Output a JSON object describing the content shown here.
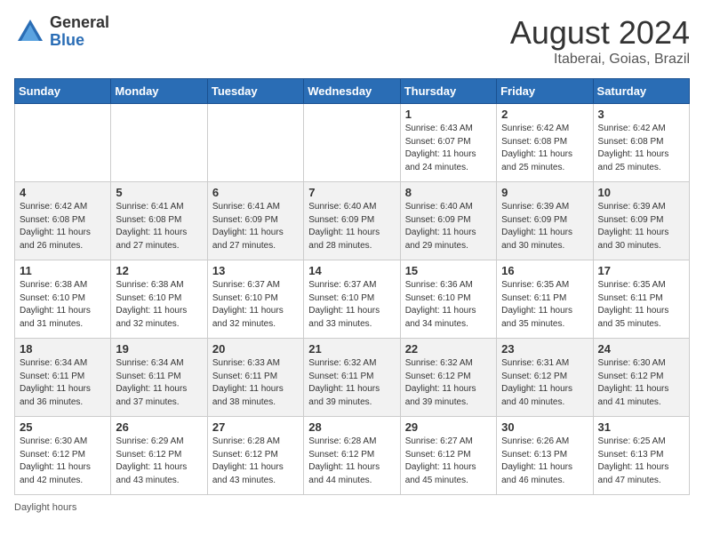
{
  "header": {
    "logo_general": "General",
    "logo_blue": "Blue",
    "month_year": "August 2024",
    "location": "Itaberai, Goias, Brazil"
  },
  "days_of_week": [
    "Sunday",
    "Monday",
    "Tuesday",
    "Wednesday",
    "Thursday",
    "Friday",
    "Saturday"
  ],
  "weeks": [
    [
      {
        "day": "",
        "info": ""
      },
      {
        "day": "",
        "info": ""
      },
      {
        "day": "",
        "info": ""
      },
      {
        "day": "",
        "info": ""
      },
      {
        "day": "1",
        "info": "Sunrise: 6:43 AM\nSunset: 6:07 PM\nDaylight: 11 hours\nand 24 minutes."
      },
      {
        "day": "2",
        "info": "Sunrise: 6:42 AM\nSunset: 6:08 PM\nDaylight: 11 hours\nand 25 minutes."
      },
      {
        "day": "3",
        "info": "Sunrise: 6:42 AM\nSunset: 6:08 PM\nDaylight: 11 hours\nand 25 minutes."
      }
    ],
    [
      {
        "day": "4",
        "info": "Sunrise: 6:42 AM\nSunset: 6:08 PM\nDaylight: 11 hours\nand 26 minutes."
      },
      {
        "day": "5",
        "info": "Sunrise: 6:41 AM\nSunset: 6:08 PM\nDaylight: 11 hours\nand 27 minutes."
      },
      {
        "day": "6",
        "info": "Sunrise: 6:41 AM\nSunset: 6:09 PM\nDaylight: 11 hours\nand 27 minutes."
      },
      {
        "day": "7",
        "info": "Sunrise: 6:40 AM\nSunset: 6:09 PM\nDaylight: 11 hours\nand 28 minutes."
      },
      {
        "day": "8",
        "info": "Sunrise: 6:40 AM\nSunset: 6:09 PM\nDaylight: 11 hours\nand 29 minutes."
      },
      {
        "day": "9",
        "info": "Sunrise: 6:39 AM\nSunset: 6:09 PM\nDaylight: 11 hours\nand 30 minutes."
      },
      {
        "day": "10",
        "info": "Sunrise: 6:39 AM\nSunset: 6:09 PM\nDaylight: 11 hours\nand 30 minutes."
      }
    ],
    [
      {
        "day": "11",
        "info": "Sunrise: 6:38 AM\nSunset: 6:10 PM\nDaylight: 11 hours\nand 31 minutes."
      },
      {
        "day": "12",
        "info": "Sunrise: 6:38 AM\nSunset: 6:10 PM\nDaylight: 11 hours\nand 32 minutes."
      },
      {
        "day": "13",
        "info": "Sunrise: 6:37 AM\nSunset: 6:10 PM\nDaylight: 11 hours\nand 32 minutes."
      },
      {
        "day": "14",
        "info": "Sunrise: 6:37 AM\nSunset: 6:10 PM\nDaylight: 11 hours\nand 33 minutes."
      },
      {
        "day": "15",
        "info": "Sunrise: 6:36 AM\nSunset: 6:10 PM\nDaylight: 11 hours\nand 34 minutes."
      },
      {
        "day": "16",
        "info": "Sunrise: 6:35 AM\nSunset: 6:11 PM\nDaylight: 11 hours\nand 35 minutes."
      },
      {
        "day": "17",
        "info": "Sunrise: 6:35 AM\nSunset: 6:11 PM\nDaylight: 11 hours\nand 35 minutes."
      }
    ],
    [
      {
        "day": "18",
        "info": "Sunrise: 6:34 AM\nSunset: 6:11 PM\nDaylight: 11 hours\nand 36 minutes."
      },
      {
        "day": "19",
        "info": "Sunrise: 6:34 AM\nSunset: 6:11 PM\nDaylight: 11 hours\nand 37 minutes."
      },
      {
        "day": "20",
        "info": "Sunrise: 6:33 AM\nSunset: 6:11 PM\nDaylight: 11 hours\nand 38 minutes."
      },
      {
        "day": "21",
        "info": "Sunrise: 6:32 AM\nSunset: 6:11 PM\nDaylight: 11 hours\nand 39 minutes."
      },
      {
        "day": "22",
        "info": "Sunrise: 6:32 AM\nSunset: 6:12 PM\nDaylight: 11 hours\nand 39 minutes."
      },
      {
        "day": "23",
        "info": "Sunrise: 6:31 AM\nSunset: 6:12 PM\nDaylight: 11 hours\nand 40 minutes."
      },
      {
        "day": "24",
        "info": "Sunrise: 6:30 AM\nSunset: 6:12 PM\nDaylight: 11 hours\nand 41 minutes."
      }
    ],
    [
      {
        "day": "25",
        "info": "Sunrise: 6:30 AM\nSunset: 6:12 PM\nDaylight: 11 hours\nand 42 minutes."
      },
      {
        "day": "26",
        "info": "Sunrise: 6:29 AM\nSunset: 6:12 PM\nDaylight: 11 hours\nand 43 minutes."
      },
      {
        "day": "27",
        "info": "Sunrise: 6:28 AM\nSunset: 6:12 PM\nDaylight: 11 hours\nand 43 minutes."
      },
      {
        "day": "28",
        "info": "Sunrise: 6:28 AM\nSunset: 6:12 PM\nDaylight: 11 hours\nand 44 minutes."
      },
      {
        "day": "29",
        "info": "Sunrise: 6:27 AM\nSunset: 6:12 PM\nDaylight: 11 hours\nand 45 minutes."
      },
      {
        "day": "30",
        "info": "Sunrise: 6:26 AM\nSunset: 6:13 PM\nDaylight: 11 hours\nand 46 minutes."
      },
      {
        "day": "31",
        "info": "Sunrise: 6:25 AM\nSunset: 6:13 PM\nDaylight: 11 hours\nand 47 minutes."
      }
    ]
  ],
  "footer": {
    "daylight_label": "Daylight hours"
  }
}
